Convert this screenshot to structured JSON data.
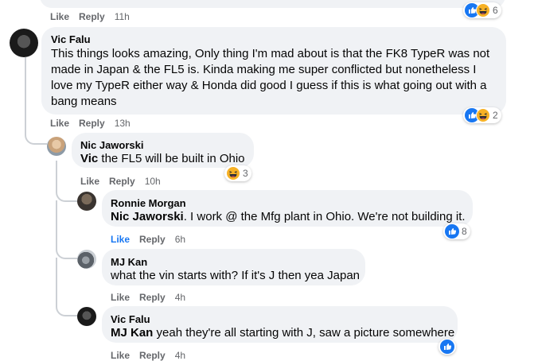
{
  "labels": {
    "like": "Like",
    "reply": "Reply"
  },
  "comments": [
    {
      "id": "c0",
      "time": "11h",
      "reactions": "6",
      "reaction_icons": [
        "like-icon",
        "haha-icon"
      ]
    },
    {
      "id": "c1",
      "author": "Vic Falu",
      "text": "This things looks amazing, Only thing I'm mad about is that the FK8 TypeR was not made in Japan & the FL5 is. Kinda making me super conflicted but nonetheless I love my TypeR either way & Honda did good I guess if this is what going out with a bang means",
      "time": "13h",
      "reactions": "2",
      "reaction_icons": [
        "like-icon",
        "haha-icon"
      ]
    },
    {
      "id": "c2",
      "author": "Nic Jaworski",
      "mention": "Vic",
      "text": " the FL5 will be built in Ohio",
      "time": "10h",
      "reactions": "3",
      "reaction_icons": [
        "haha-icon"
      ]
    },
    {
      "id": "c3",
      "author": "Ronnie Morgan",
      "mention": "Nic Jaworski",
      "text": ". I work @ the Mfg plant in Ohio. We're not building it.",
      "time": "6h",
      "reactions": "8",
      "reaction_icons": [
        "like-icon"
      ],
      "like_active": true
    },
    {
      "id": "c4",
      "author": "MJ Kan",
      "text": "what the vin starts with? If it's J then yea Japan",
      "time": "4h"
    },
    {
      "id": "c5",
      "author": "Vic Falu",
      "mention": "MJ Kan",
      "text": " yeah they're all starting with J, saw a picture somewhere",
      "time": "4h",
      "reaction_icons": [
        "like-icon"
      ]
    }
  ],
  "colors": {
    "bubble": "#f0f2f5",
    "like_blue": "#1877f2",
    "haha_yellow": "#f7b125",
    "meta_gray": "#65676b"
  }
}
